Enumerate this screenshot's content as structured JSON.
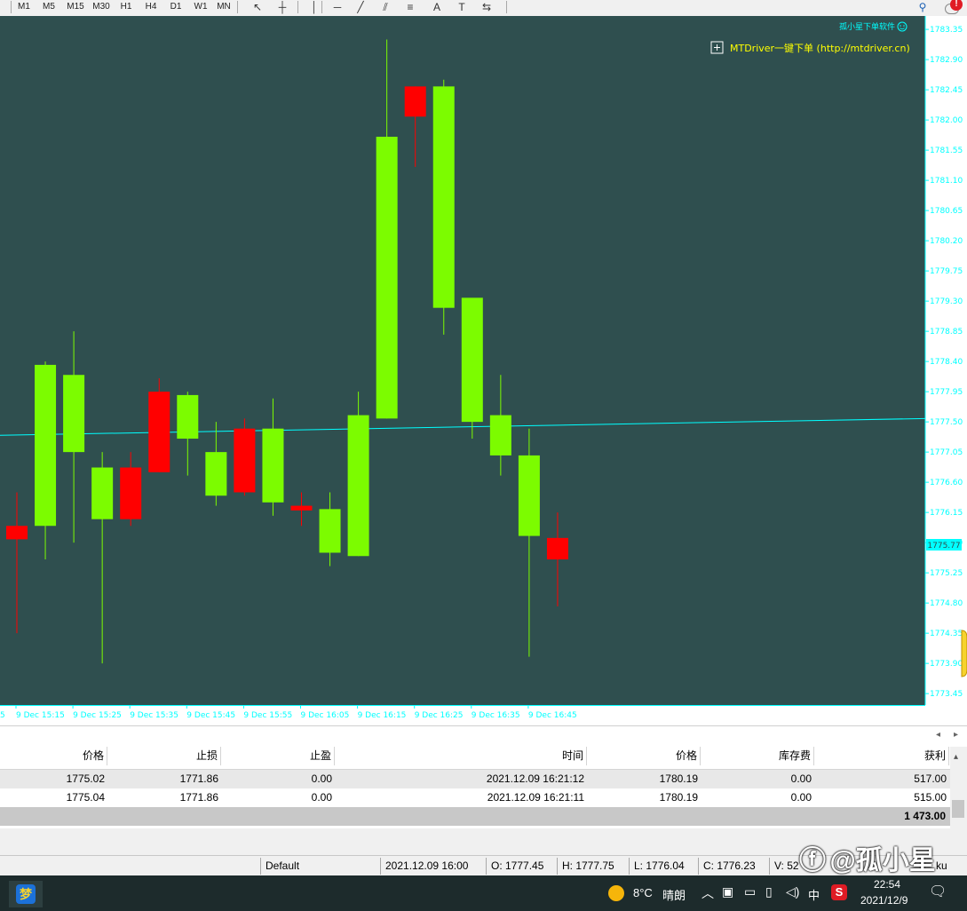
{
  "toolbar": {
    "timeframes": [
      "M1",
      "M5",
      "M15",
      "M30",
      "H1",
      "H4",
      "D1",
      "W1",
      "MN"
    ],
    "tools": [
      {
        "name": "cursor-icon",
        "glyph": "↖"
      },
      {
        "name": "crosshair-icon",
        "glyph": "┼"
      },
      {
        "name": "vertical-line-icon",
        "glyph": "│"
      },
      {
        "name": "horizontal-line-icon",
        "glyph": "─"
      },
      {
        "name": "trendline-icon",
        "glyph": "╱"
      },
      {
        "name": "equidistant-channel-icon",
        "glyph": "⫽"
      },
      {
        "name": "fibonacci-icon",
        "glyph": "≡"
      },
      {
        "name": "text-icon",
        "glyph": "A"
      },
      {
        "name": "text-label-icon",
        "glyph": "T"
      },
      {
        "name": "arrows-icon",
        "glyph": "⇆"
      }
    ]
  },
  "chart": {
    "watermark": "孤小星下单软件",
    "link_text": "MTDriver一键下单 (http://mtdriver.cn)",
    "current_price_label": "1775.77",
    "bg_color": "#2f4f4f",
    "bull_color": "#7cfc00",
    "bear_color": "#ff0000",
    "axis_color": "#00ffff"
  },
  "chart_data": {
    "type": "candlestick",
    "symbol": "",
    "price_range": [
      1773.28,
      1783.55
    ],
    "y_ticks": [
      1783.35,
      1782.9,
      1782.45,
      1782.0,
      1781.55,
      1781.1,
      1780.65,
      1780.2,
      1779.75,
      1779.3,
      1778.85,
      1778.4,
      1777.95,
      1777.5,
      1777.05,
      1776.6,
      1776.15,
      1775.7,
      1775.25,
      1774.8,
      1774.35,
      1773.9,
      1773.45
    ],
    "x_labels": [
      "9 Dec 15:15",
      "9 Dec 15:25",
      "9 Dec 15:35",
      "9 Dec 15:45",
      "9 Dec 15:55",
      "9 Dec 16:05",
      "9 Dec 16:15",
      "9 Dec 16:25",
      "9 Dec 16:35",
      "9 Dec 16:45"
    ],
    "x_label_partial": "5",
    "candles": [
      {
        "open": 1775.95,
        "high": 1776.45,
        "low": 1774.35,
        "close": 1775.75
      },
      {
        "open": 1775.95,
        "high": 1778.4,
        "low": 1775.45,
        "close": 1778.35
      },
      {
        "open": 1777.05,
        "high": 1778.85,
        "low": 1775.7,
        "close": 1778.2
      },
      {
        "open": 1776.05,
        "high": 1777.05,
        "low": 1773.9,
        "close": 1776.82
      },
      {
        "open": 1776.82,
        "high": 1777.05,
        "low": 1775.95,
        "close": 1776.05
      },
      {
        "open": 1777.95,
        "high": 1778.15,
        "low": 1776.75,
        "close": 1776.75
      },
      {
        "open": 1777.25,
        "high": 1777.95,
        "low": 1776.7,
        "close": 1777.9
      },
      {
        "open": 1776.4,
        "high": 1777.5,
        "low": 1776.25,
        "close": 1777.05
      },
      {
        "open": 1777.4,
        "high": 1777.55,
        "low": 1776.4,
        "close": 1776.45
      },
      {
        "open": 1776.3,
        "high": 1777.85,
        "low": 1776.1,
        "close": 1777.4
      },
      {
        "open": 1776.25,
        "high": 1776.45,
        "low": 1775.95,
        "close": 1776.18
      },
      {
        "open": 1775.55,
        "high": 1776.45,
        "low": 1775.35,
        "close": 1776.2
      },
      {
        "open": 1775.5,
        "high": 1777.95,
        "low": 1775.5,
        "close": 1777.6
      },
      {
        "open": 1777.55,
        "high": 1783.2,
        "low": 1777.55,
        "close": 1781.75
      },
      {
        "open": 1782.5,
        "high": 1782.5,
        "low": 1781.3,
        "close": 1782.05
      },
      {
        "open": 1779.2,
        "high": 1782.6,
        "low": 1778.8,
        "close": 1782.5
      },
      {
        "open": 1777.5,
        "high": 1779.3,
        "low": 1777.25,
        "close": 1779.35
      },
      {
        "open": 1777.0,
        "high": 1778.2,
        "low": 1776.7,
        "close": 1777.6
      },
      {
        "open": 1775.8,
        "high": 1777.4,
        "low": 1774.0,
        "close": 1777.0
      },
      {
        "open": 1775.77,
        "high": 1776.15,
        "low": 1774.75,
        "close": 1775.45
      }
    ],
    "horizontal_line": {
      "from_price": 1777.3,
      "to_price": 1777.55
    }
  },
  "table": {
    "headers": [
      "价格",
      "止损",
      "止盈",
      "时间",
      "价格",
      "库存费",
      "获利"
    ],
    "rows": [
      [
        "1775.02",
        "1771.86",
        "0.00",
        "2021.12.09 16:21:12",
        "1780.19",
        "0.00",
        "517.00"
      ],
      [
        "1775.04",
        "1771.86",
        "0.00",
        "2021.12.09 16:21:11",
        "1780.19",
        "0.00",
        "515.00"
      ]
    ],
    "total": "1 473.00"
  },
  "status": {
    "profile": "Default",
    "time": "2021.12.09 16:00",
    "open": "O: 1777.45",
    "high": "H: 1777.75",
    "low": "L: 1776.04",
    "close": "C: 1776.23",
    "volume": "V: 52",
    "traffic": "ku"
  },
  "watermark_overlay": "@孤小星",
  "taskbar": {
    "weather_temp": "8°C",
    "weather_desc": "晴朗",
    "ime": "中",
    "time": "22:54",
    "date": "2021/12/9"
  }
}
